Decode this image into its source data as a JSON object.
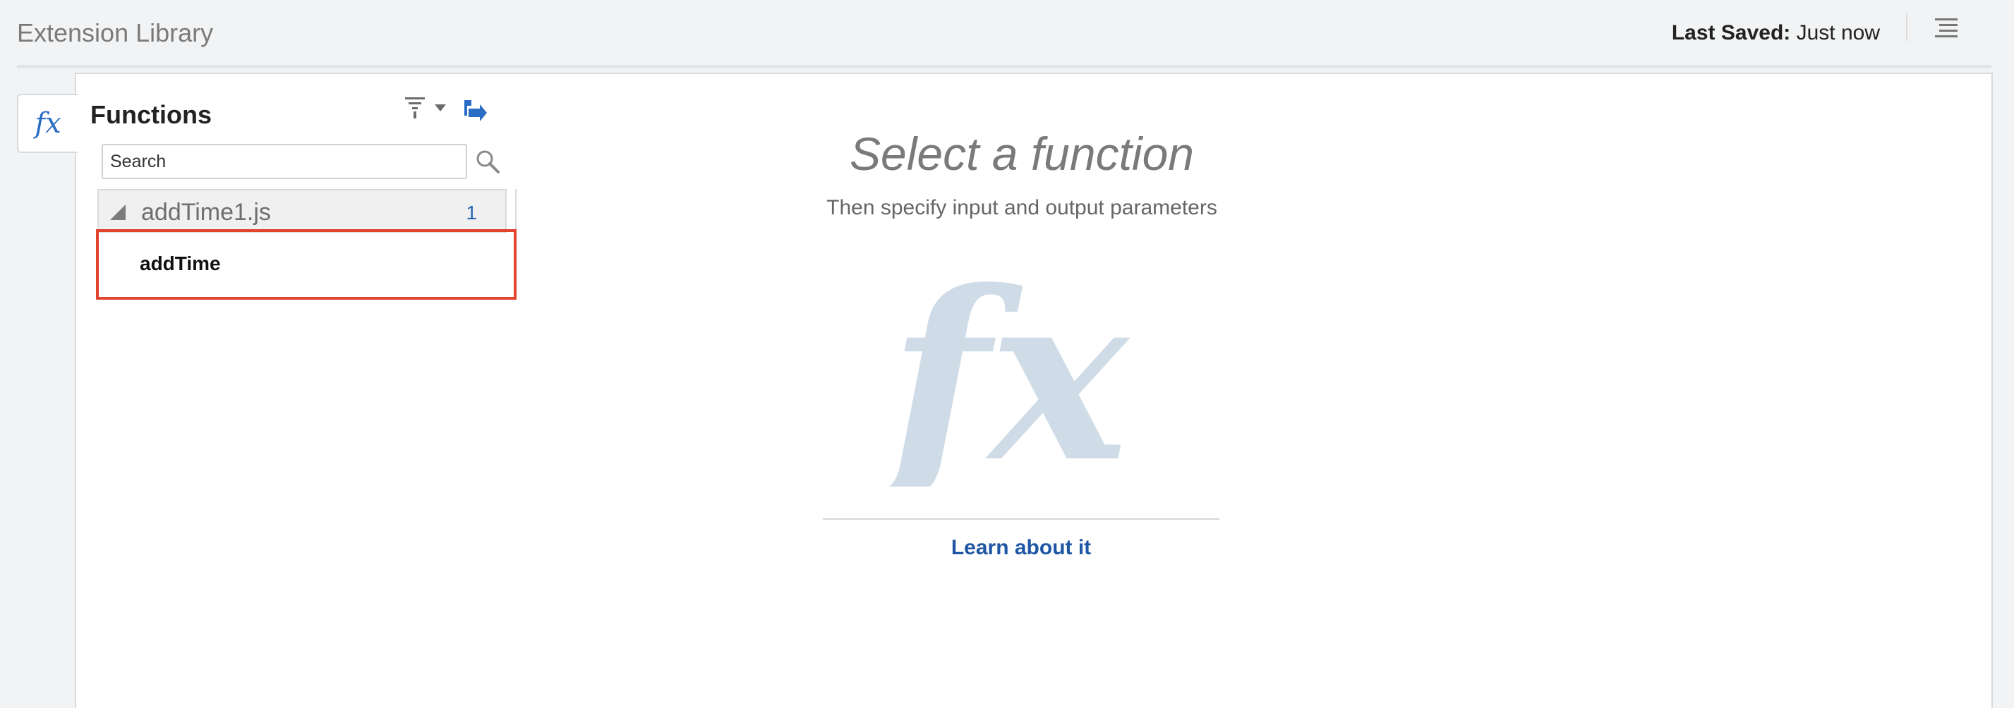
{
  "header": {
    "title": "Extension Library",
    "last_saved_label": "Last Saved:",
    "last_saved_value": "Just now",
    "menu_icon": "hamburger-menu-icon"
  },
  "side_tab": {
    "icon": "fx-icon",
    "icon_text": "fx"
  },
  "functions_panel": {
    "title": "Functions",
    "filter_icon": "filter-icon",
    "import_icon": "import-icon",
    "search": {
      "placeholder": "Search",
      "value": ""
    },
    "search_icon": "search-icon",
    "tree": {
      "group_name": "addTime1.js",
      "group_count": "1",
      "items": [
        {
          "label": "addTime"
        }
      ]
    }
  },
  "empty_state": {
    "title": "Select a function",
    "subtitle": "Then specify input and output parameters",
    "watermark": "fx-watermark-icon",
    "watermark_text": "fx",
    "link_label": "Learn about it"
  },
  "colors": {
    "accent_blue": "#2867b2",
    "link_blue": "#1f57a4",
    "highlight_red": "#e0442e",
    "watermark": "#cfdbe6"
  }
}
